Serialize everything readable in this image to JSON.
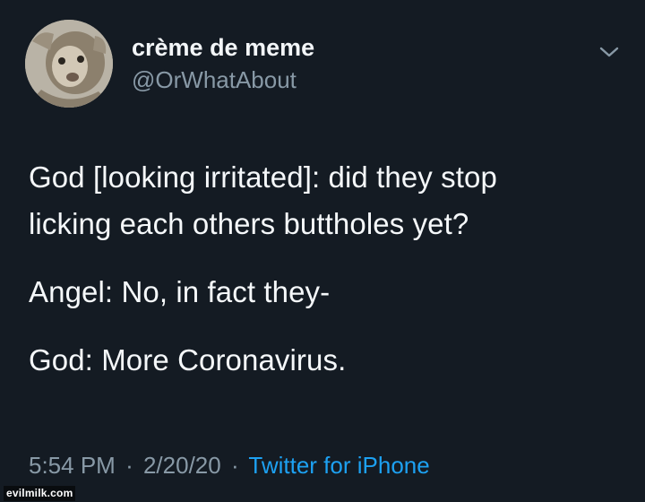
{
  "tweet": {
    "author": {
      "display_name": "crème de meme",
      "handle": "@OrWhatAbout",
      "avatar_icon": "avatar-photo"
    },
    "menu_icon": "chevron-down-icon",
    "lines": [
      "God [looking irritated]: did they stop",
      "licking each others buttholes yet?",
      "Angel: No, in fact they-",
      "God: More Coronavirus."
    ],
    "meta": {
      "time": "5:54 PM",
      "separator": "·",
      "date": "2/20/20",
      "client": "Twitter for iPhone"
    }
  },
  "watermark": "evilmilk.com",
  "colors": {
    "background": "#141b23",
    "text": "#f5f8fa",
    "muted": "#8899a6",
    "accent": "#1da1f2"
  }
}
